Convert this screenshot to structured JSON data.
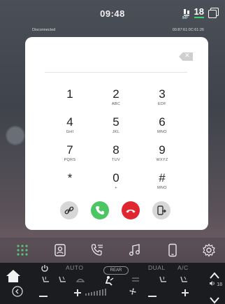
{
  "status_bar": {
    "time": "09:48",
    "temperature": "18",
    "temp_unit_label": "IMP"
  },
  "call": {
    "connection_status": "Disconnected",
    "timer": "00:87:61:0C:61:26"
  },
  "keypad": {
    "keys": [
      {
        "digit": "1",
        "letters": ""
      },
      {
        "digit": "2",
        "letters": "ABC"
      },
      {
        "digit": "3",
        "letters": "EDF"
      },
      {
        "digit": "4",
        "letters": "GHI"
      },
      {
        "digit": "5",
        "letters": "JKL"
      },
      {
        "digit": "6",
        "letters": "MNO"
      },
      {
        "digit": "7",
        "letters": "PQRS"
      },
      {
        "digit": "8",
        "letters": "TUV"
      },
      {
        "digit": "9",
        "letters": "WXYZ"
      },
      {
        "digit": "*",
        "letters": ""
      },
      {
        "digit": "0",
        "letters": "+"
      },
      {
        "digit": "#",
        "letters": "MNO"
      }
    ],
    "backspace_symbol": "✕",
    "actions": [
      "link-icon",
      "call-icon",
      "end-call-icon",
      "transfer-icon"
    ]
  },
  "dock": {
    "items": [
      "apps-grid-icon",
      "contacts-icon",
      "call-log-icon",
      "music-icon",
      "phone-device-icon",
      "settings-icon"
    ]
  },
  "climate": {
    "auto_label": "AUTO",
    "rear_label": "REAR",
    "dual_label": "DUAL",
    "ac_label": "A/C",
    "volume": "18",
    "colors": {
      "accent_green": "#3fd46b",
      "call_green": "#4cc563",
      "end_red": "#e0262f"
    }
  }
}
